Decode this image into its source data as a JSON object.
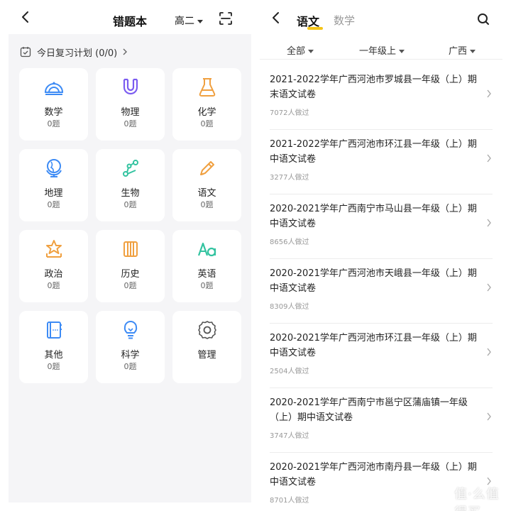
{
  "left": {
    "title": "错题本",
    "grade": "高二",
    "plan": "今日复习计划 (0/0)",
    "subjects": [
      {
        "name": "数学",
        "count": "0题",
        "icon": "protractor-icon",
        "color": "#3d8bf5"
      },
      {
        "name": "物理",
        "count": "0题",
        "icon": "magnet-icon",
        "color": "#7b5cf0"
      },
      {
        "name": "化学",
        "count": "0题",
        "icon": "flask-icon",
        "color": "#f0a040"
      },
      {
        "name": "地理",
        "count": "0题",
        "icon": "globe-icon",
        "color": "#3d8bf5"
      },
      {
        "name": "生物",
        "count": "0题",
        "icon": "molecule-icon",
        "color": "#33c3a0"
      },
      {
        "name": "语文",
        "count": "0题",
        "icon": "pencil-icon",
        "color": "#f0a040"
      },
      {
        "name": "政治",
        "count": "0题",
        "icon": "star-badge-icon",
        "color": "#f0a040"
      },
      {
        "name": "历史",
        "count": "0题",
        "icon": "scroll-icon",
        "color": "#f0a040"
      },
      {
        "name": "英语",
        "count": "0题",
        "icon": "abc-icon",
        "color": "#33c3a0"
      },
      {
        "name": "其他",
        "count": "0题",
        "icon": "notebook-icon",
        "color": "#3d8bf5"
      },
      {
        "name": "科学",
        "count": "0题",
        "icon": "lightbulb-icon",
        "color": "#3d8bf5"
      },
      {
        "name": "管理",
        "count": "",
        "icon": "gear-icon",
        "color": "#555555"
      }
    ]
  },
  "right": {
    "tab_active": "语文",
    "tab_inactive": "数学",
    "filters": [
      "全部",
      "一年级上",
      "广西"
    ],
    "papers": [
      {
        "title": "2021-2022学年广西河池市罗城县一年级（上）期末语文试卷",
        "count": "7072人做过"
      },
      {
        "title": "2021-2022学年广西河池市环江县一年级（上）期中语文试卷",
        "count": "3277人做过"
      },
      {
        "title": "2020-2021学年广西南宁市马山县一年级（上）期中语文试卷",
        "count": "8656人做过"
      },
      {
        "title": "2020-2021学年广西河池市天峨县一年级（上）期中语文试卷",
        "count": "8309人做过"
      },
      {
        "title": "2020-2021学年广西河池市环江县一年级（上）期中语文试卷",
        "count": "2504人做过"
      },
      {
        "title": "2020-2021学年广西南宁市邕宁区蒲庙镇一年级（上）期中语文试卷",
        "count": "3747人做过"
      },
      {
        "title": "2020-2021学年广西河池市南丹县一年级（上）期中语文试卷",
        "count": "8701人做过"
      }
    ]
  },
  "watermark": "值·么值得买"
}
